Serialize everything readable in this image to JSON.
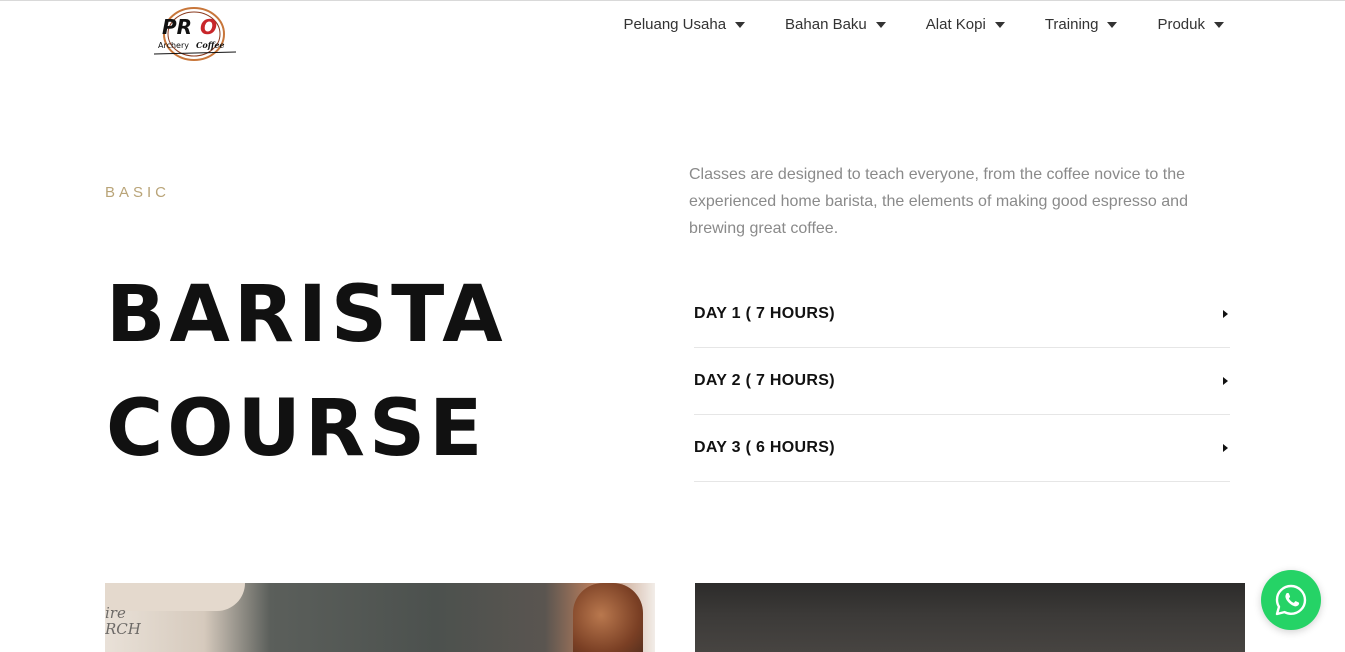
{
  "header": {
    "logo": {
      "brand": "PRO",
      "sub": "Archery & Coffee",
      "icon": "logo-icon"
    },
    "nav": [
      {
        "label": "Peluang Usaha"
      },
      {
        "label": "Bahan Baku"
      },
      {
        "label": "Alat Kopi"
      },
      {
        "label": "Training"
      },
      {
        "label": "Produk"
      }
    ]
  },
  "hero": {
    "eyebrow": "BASIC",
    "title_line1": "BARISTA",
    "title_line2": "COURSE",
    "intro": "Classes are designed to teach everyone, from the coffee novice to the experienced home barista, the elements of making good espresso and brewing great coffee.",
    "accordion": [
      {
        "title": "DAY 1 ( 7 HOURS)"
      },
      {
        "title": "DAY 2 ( 7 HOURS)"
      },
      {
        "title": "DAY 3 ( 6 HOURS)"
      }
    ]
  },
  "gallery": {
    "tattoo_text": "ire\nRCH"
  },
  "whatsapp": {
    "icon": "whatsapp-icon",
    "color": "#25d366"
  },
  "colors": {
    "accent": "#b9a478",
    "text_dark": "#111111",
    "text_muted": "#8a8a8a"
  }
}
